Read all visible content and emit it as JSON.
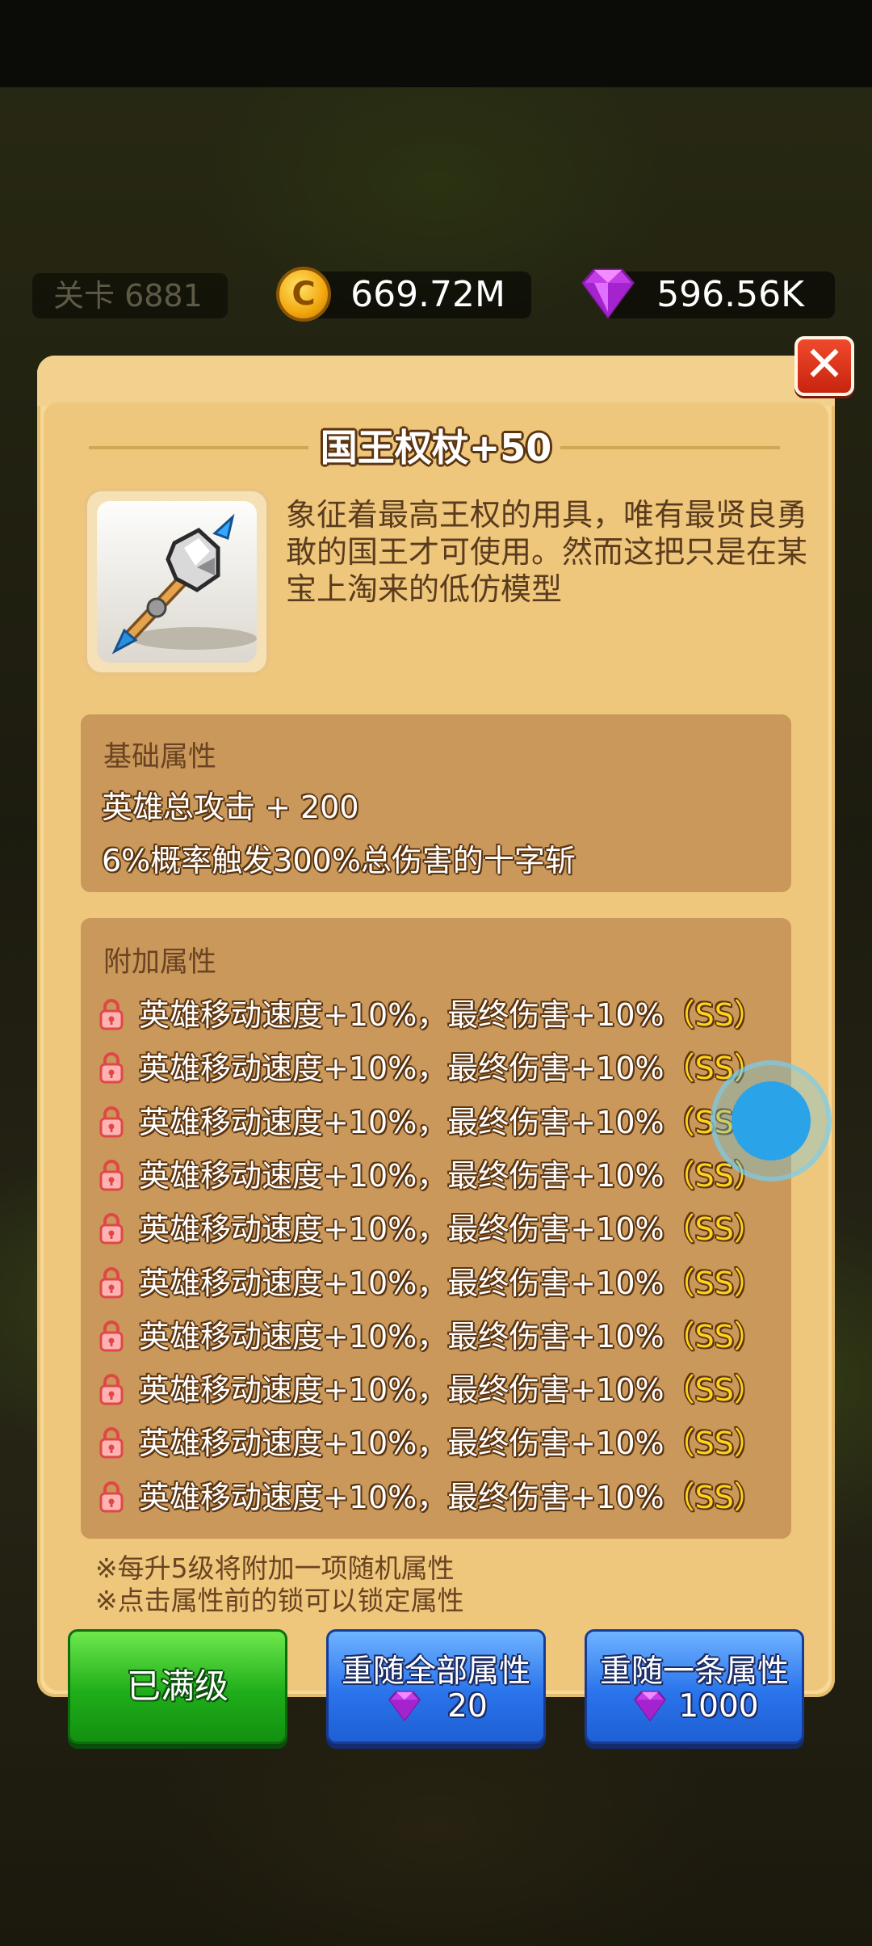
{
  "hud": {
    "stage": "关卡 6881",
    "coins": "669.72M",
    "gems": "596.56K",
    "coin_symbol": "C"
  },
  "dialog": {
    "title": "国王权杖+50",
    "close_symbol": "✕",
    "description": "象征着最高王权的用具，唯有最贤良勇敢的国王才可使用。然而这把只是在某宝上淘来的低仿模型",
    "base": {
      "heading": "基础属性",
      "lines": [
        "英雄总攻击 + 200",
        "6%概率触发300%总伤害的十字斩"
      ]
    },
    "extra": {
      "heading": "附加属性",
      "rows": [
        {
          "text": "英雄移动速度+10%，最终伤害+10%",
          "grade": "（SS）"
        },
        {
          "text": "英雄移动速度+10%，最终伤害+10%",
          "grade": "（SS）"
        },
        {
          "text": "英雄移动速度+10%，最终伤害+10%",
          "grade": "（SS）"
        },
        {
          "text": "英雄移动速度+10%，最终伤害+10%",
          "grade": "（SS）"
        },
        {
          "text": "英雄移动速度+10%，最终伤害+10%",
          "grade": "（SS）"
        },
        {
          "text": "英雄移动速度+10%，最终伤害+10%",
          "grade": "（SS）"
        },
        {
          "text": "英雄移动速度+10%，最终伤害+10%",
          "grade": "（SS）"
        },
        {
          "text": "英雄移动速度+10%，最终伤害+10%",
          "grade": "（SS）"
        },
        {
          "text": "英雄移动速度+10%，最终伤害+10%",
          "grade": "（SS）"
        },
        {
          "text": "英雄移动速度+10%，最终伤害+10%",
          "grade": "（SS）"
        }
      ]
    },
    "notes": [
      "※每升5级将附加一项随机属性",
      "※点击属性前的锁可以锁定属性"
    ],
    "buttons": {
      "max_level": "已满级",
      "reroll_all": {
        "label": "重随全部属性",
        "cost": "20"
      },
      "reroll_one": {
        "label": "重随一条属性",
        "cost": "1000"
      }
    }
  },
  "colors": {
    "panel": "#f7d897",
    "attr_box": "#c9985a",
    "grade": "#ffd21e",
    "green_button": "#1fae1a",
    "blue_button": "#2a74ec",
    "close_button": "#e0361d"
  }
}
